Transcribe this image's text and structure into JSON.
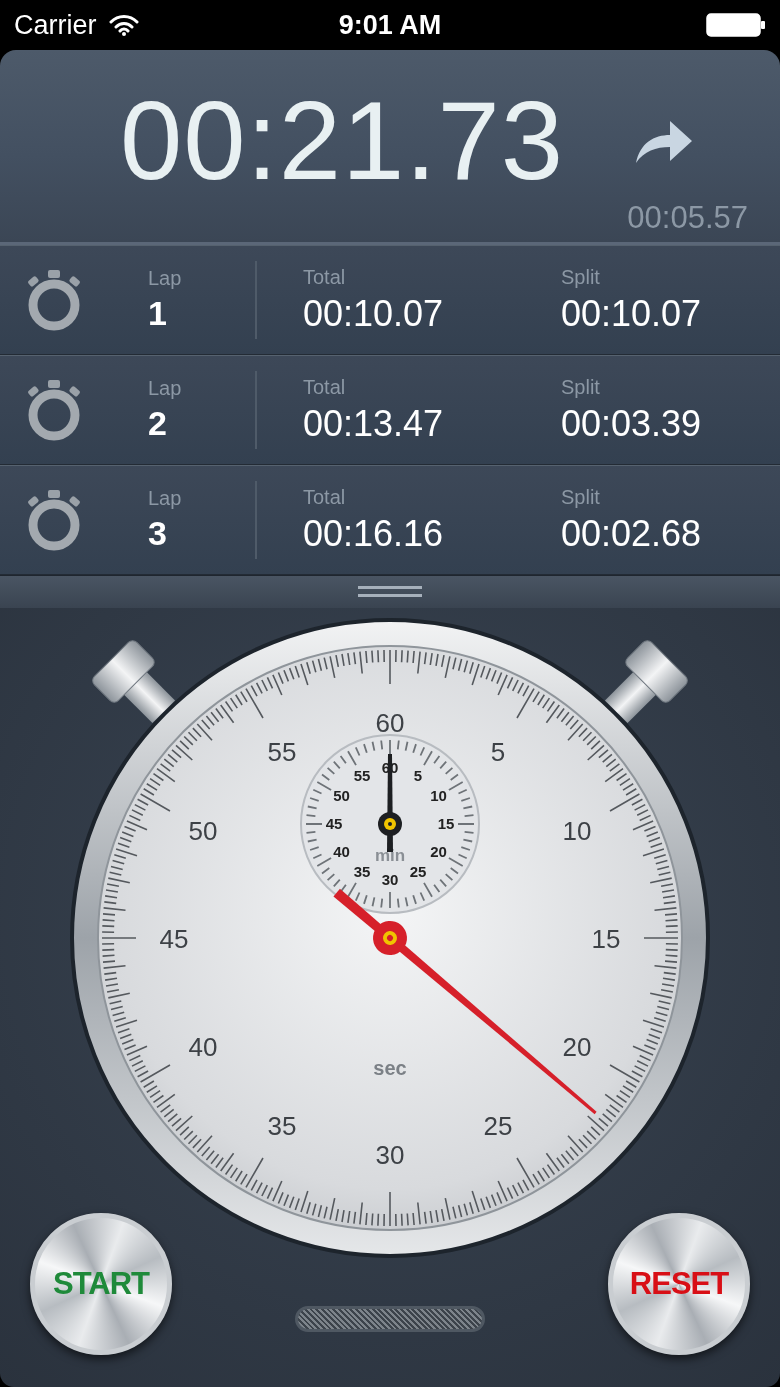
{
  "status_bar": {
    "carrier": "Carrier",
    "time": "9:01 AM"
  },
  "display": {
    "main_time": "00:21.73",
    "lap_time": "00:05.57"
  },
  "laps": [
    {
      "lap_label": "Lap",
      "lap": "1",
      "total_label": "Total",
      "total": "00:10.07",
      "split_label": "Split",
      "split": "00:10.07"
    },
    {
      "lap_label": "Lap",
      "lap": "2",
      "total_label": "Total",
      "total": "00:13.47",
      "split_label": "Split",
      "split": "00:03.39"
    },
    {
      "lap_label": "Lap",
      "lap": "3",
      "total_label": "Total",
      "total": "00:16.16",
      "split_label": "Split",
      "split": "00:02.68"
    }
  ],
  "dial": {
    "second_labels": [
      "60",
      "55",
      "5",
      "50",
      "10",
      "45",
      "15",
      "40",
      "20",
      "35",
      "25",
      "30"
    ],
    "minute_labels": [
      "60",
      "55",
      "5",
      "50",
      "10",
      "45",
      "15",
      "40",
      "20",
      "35",
      "25",
      "30"
    ],
    "minute_unit": "min",
    "second_unit": "sec"
  },
  "buttons": [
    {
      "label": "START",
      "color": "#1f8a3a"
    },
    {
      "label": "RESET",
      "color": "#d80f16"
    }
  ]
}
